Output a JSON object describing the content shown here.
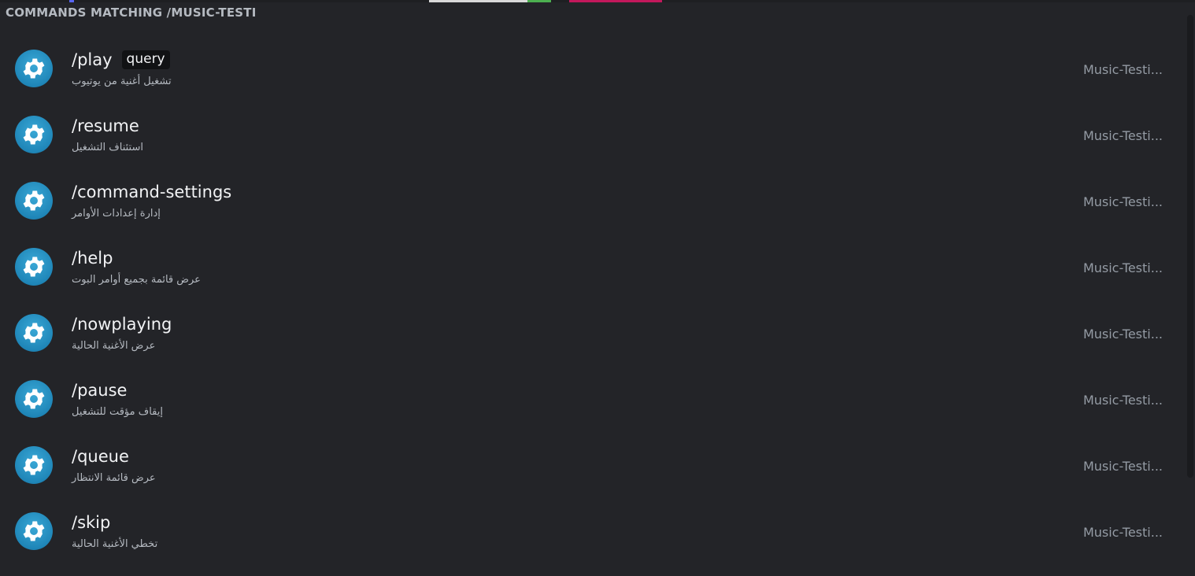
{
  "header": {
    "title": "COMMANDS MATCHING /MUSIC-TESTI"
  },
  "commands": [
    {
      "name": "/play",
      "option": "query",
      "description": "تشغيل أغنية من يوتيوب",
      "source": "Music-Testi..."
    },
    {
      "name": "/resume",
      "option": "",
      "description": "استئناف التشغيل",
      "source": "Music-Testi..."
    },
    {
      "name": "/command-settings",
      "option": "",
      "description": "إدارة إعدادات الأوامر",
      "source": "Music-Testi..."
    },
    {
      "name": "/help",
      "option": "",
      "description": "عرض قائمة بجميع أوامر البوت",
      "source": "Music-Testi..."
    },
    {
      "name": "/nowplaying",
      "option": "",
      "description": "عرض الأغنية الحالية",
      "source": "Music-Testi..."
    },
    {
      "name": "/pause",
      "option": "",
      "description": "إيقاف مؤقت للتشغيل",
      "source": "Music-Testi..."
    },
    {
      "name": "/queue",
      "option": "",
      "description": "عرض قائمة الانتظار",
      "source": "Music-Testi..."
    },
    {
      "name": "/skip",
      "option": "",
      "description": "تخطي الأغنية الحالية",
      "source": "Music-Testi..."
    }
  ],
  "icons": {
    "command_avatar": "gear-icon"
  },
  "colors": {
    "background": "#232428",
    "avatar": "#1f86b8"
  }
}
